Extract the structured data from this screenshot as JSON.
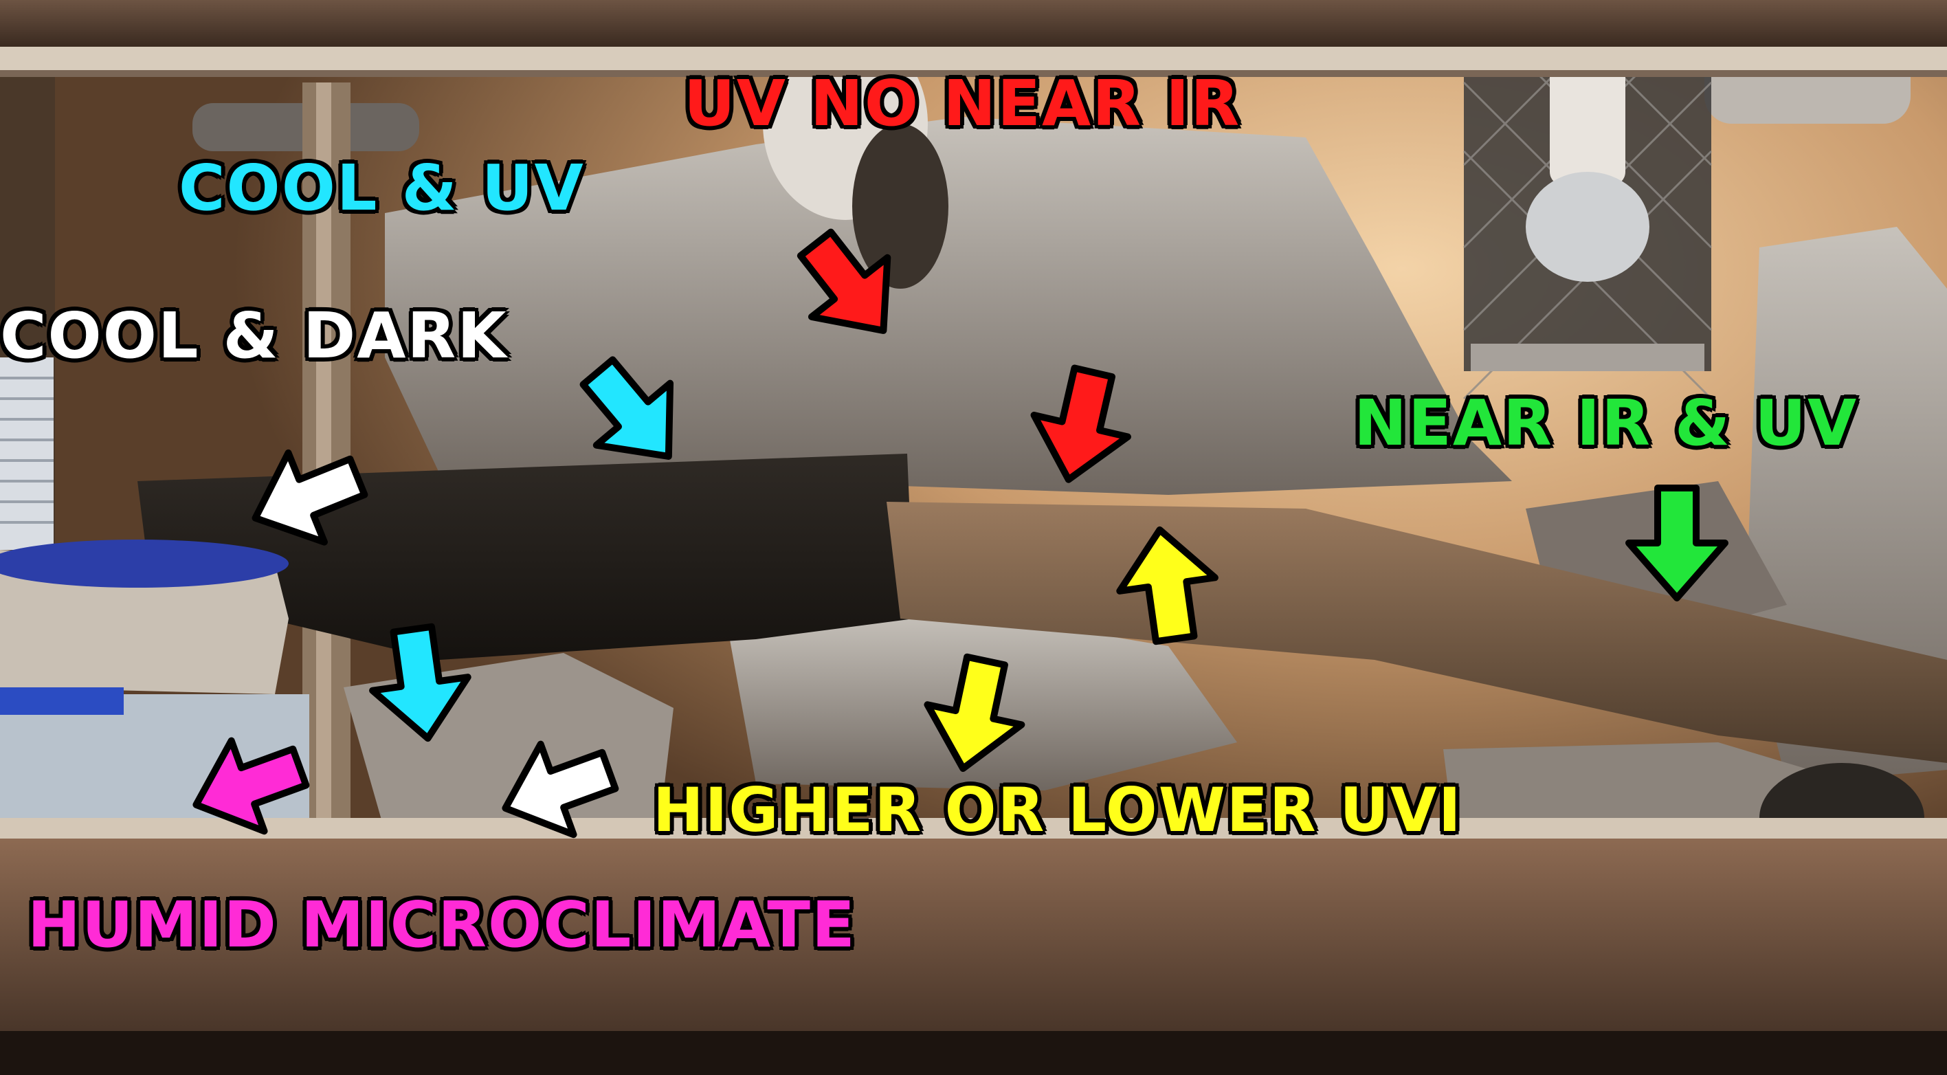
{
  "annotations": {
    "uv_no_near_ir": {
      "text": "UV NO NEAR IR",
      "color": "#ff1a1a"
    },
    "cool_uv": {
      "text": "COOL & UV",
      "color": "#22e6ff"
    },
    "cool_dark": {
      "text": "COOL & DARK",
      "color": "#ffffff"
    },
    "near_ir_uv": {
      "text": "NEAR IR & UV",
      "color": "#22e63a"
    },
    "higher_lower_uvi": {
      "text": "HIGHER OR LOWER UVI",
      "color": "#ffff1a"
    },
    "humid_microclimate": {
      "text": "HUMID MICROCLIMATE",
      "color": "#ff2bd6"
    }
  },
  "arrows": [
    {
      "name": "red-arrow-upper",
      "color": "#ff1a1a"
    },
    {
      "name": "red-arrow-lower",
      "color": "#ff1a1a"
    },
    {
      "name": "cyan-arrow-upper",
      "color": "#22e6ff"
    },
    {
      "name": "cyan-arrow-lower",
      "color": "#22e6ff"
    },
    {
      "name": "white-arrow-upper",
      "color": "#ffffff"
    },
    {
      "name": "white-arrow-lower",
      "color": "#ffffff"
    },
    {
      "name": "green-arrow",
      "color": "#22e63a"
    },
    {
      "name": "yellow-arrow-up",
      "color": "#ffff1a"
    },
    {
      "name": "yellow-arrow-down",
      "color": "#ffff1a"
    },
    {
      "name": "magenta-arrow",
      "color": "#ff2bd6"
    }
  ]
}
